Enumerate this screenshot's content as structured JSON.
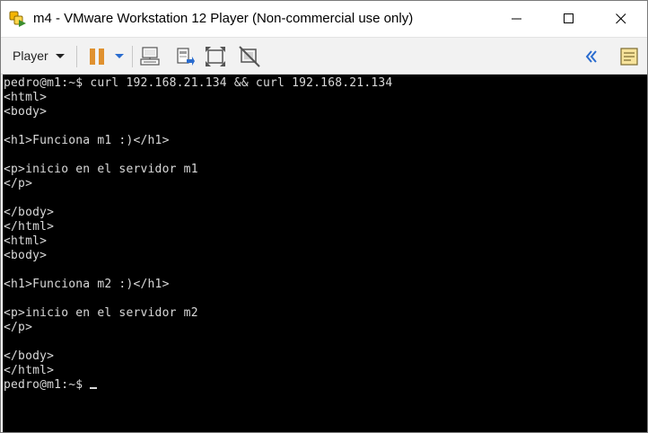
{
  "window": {
    "title": "m4 - VMware Workstation 12 Player (Non-commercial use only)",
    "icon": "vmware-player-icon"
  },
  "window_controls": {
    "minimize": "minimize-icon",
    "maximize": "maximize-icon",
    "close": "close-icon"
  },
  "toolbar": {
    "player_menu_label": "Player",
    "buttons": [
      "pause-icon",
      "dropdown-arrow-icon",
      "send-ctrl-alt-del-icon",
      "removable-devices-icon",
      "fit-guest-icon",
      "unity-icon",
      "collapse-toolbar-icon",
      "library-notes-icon"
    ],
    "accent_color": "#2a6ccf",
    "pause_color": "#e0912f"
  },
  "console": {
    "background": "#000000",
    "foreground": "#d9d9d9",
    "lines": [
      "pedro@m1:~$ curl 192.168.21.134 && curl 192.168.21.134",
      "<html>",
      "<body>",
      "",
      "<h1>Funciona m1 :)</h1>",
      "",
      "<p>inicio en el servidor m1",
      "</p>",
      "",
      "</body>",
      "</html>",
      "<html>",
      "<body>",
      "",
      "<h1>Funciona m2 :)</h1>",
      "",
      "<p>inicio en el servidor m2",
      "</p>",
      "",
      "</body>",
      "</html>"
    ],
    "prompt": "pedro@m1:~$ "
  }
}
